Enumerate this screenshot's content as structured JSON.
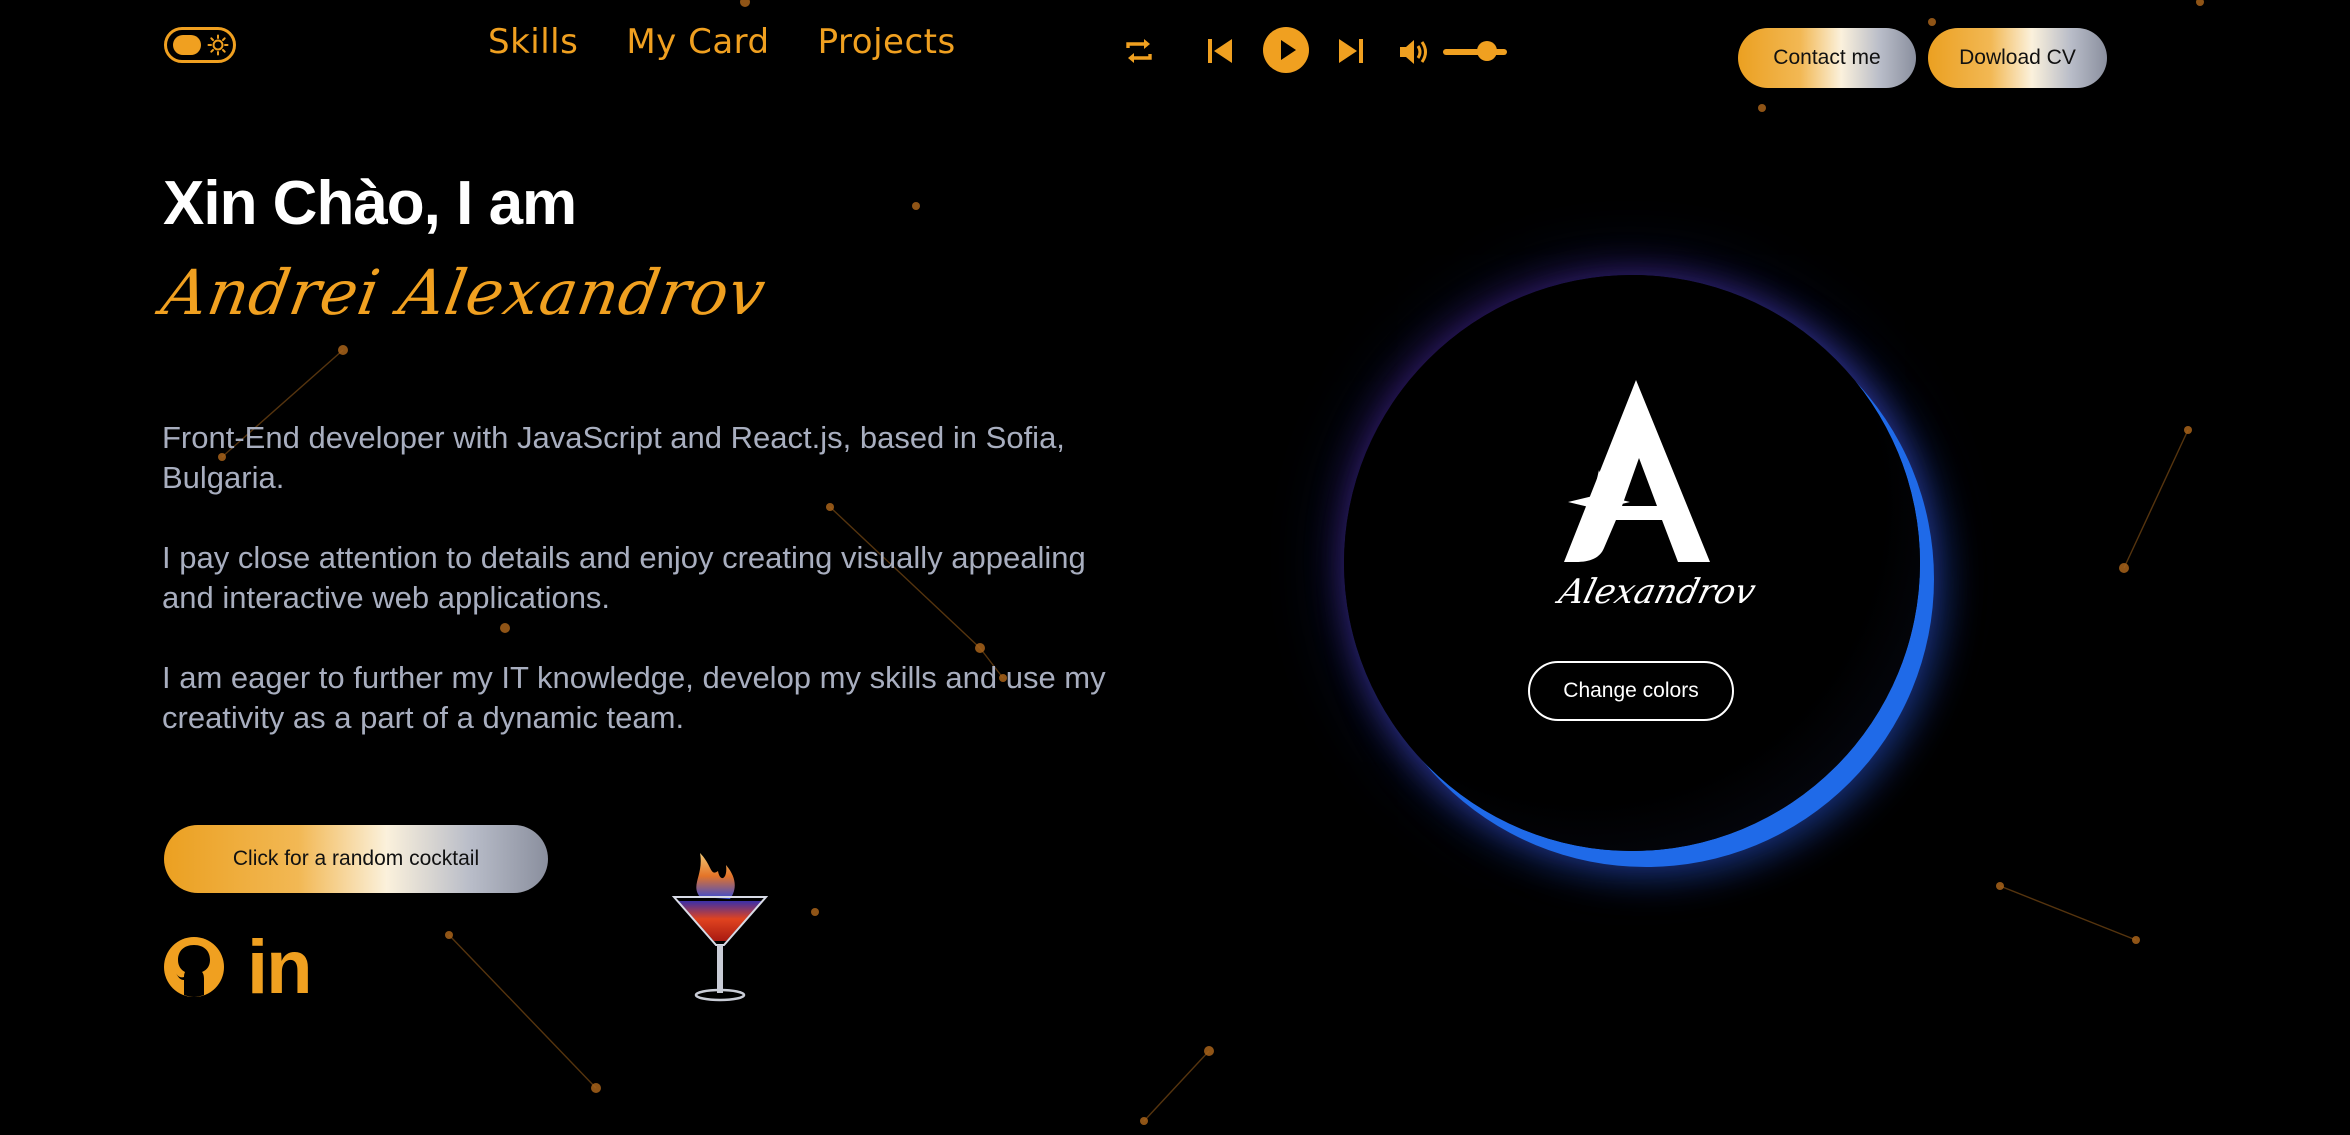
{
  "colors": {
    "accent": "#f0a020",
    "background": "#000000",
    "body_text": "#a8aebf",
    "orb_glow": "#1f6ae8"
  },
  "header": {
    "theme_toggle_icons": [
      "toggle-knob",
      "sun-icon"
    ],
    "nav": [
      {
        "label": "Skills"
      },
      {
        "label": "My Card"
      },
      {
        "label": "Projects"
      }
    ],
    "player": {
      "icons": [
        "repeat-icon",
        "skip-back-icon",
        "play-icon",
        "skip-forward-icon",
        "volume-icon"
      ],
      "volume": 0.6
    },
    "contact_label": "Contact me",
    "cv_label": "Dowload CV"
  },
  "hero": {
    "greeting": "Xin Chào, I am",
    "name": "Andrei Alexandrov",
    "bio": [
      "Front-End developer with JavaScript and React.js, based in Sofia, Bulgaria.",
      "I pay close attention to details and enjoy creating visually appealing and interactive web applications.",
      "I am eager to further my IT knowledge, develop my skills and use my creativity as a part of a dynamic team."
    ],
    "cocktail_button": "Click for a random cocktail",
    "social_icons": [
      "github-icon",
      "linkedin-icon"
    ],
    "linkedin_text": "in"
  },
  "logo_card": {
    "monogram": "A",
    "signature": "Alexandrov",
    "change_colors_label": "Change colors"
  }
}
